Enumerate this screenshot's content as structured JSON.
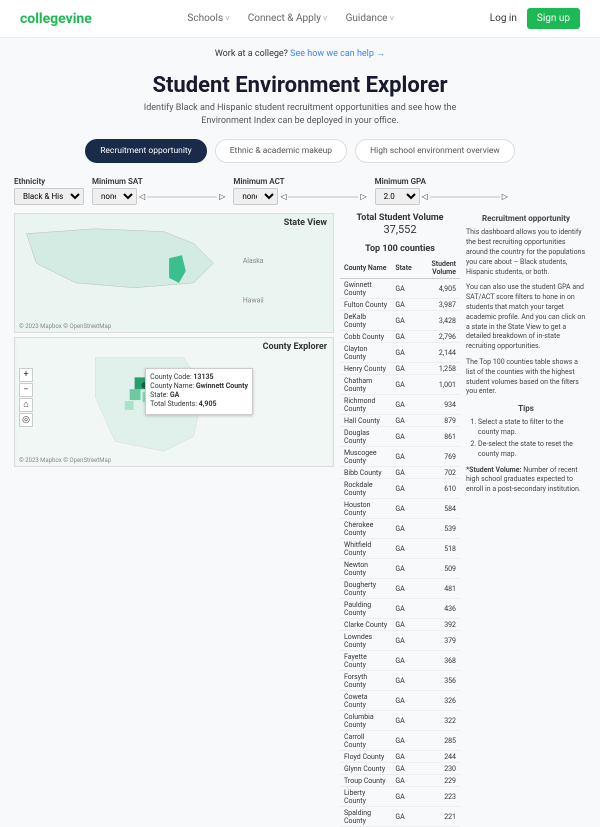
{
  "nav": {
    "logo_a": "college",
    "logo_b": "vine",
    "links": [
      "Schools",
      "Connect & Apply",
      "Guidance"
    ],
    "login": "Log in",
    "signup": "Sign up"
  },
  "banner": {
    "prefix": "Work at a college? ",
    "link": "See how we can help  →"
  },
  "title": "Student Environment Explorer",
  "subtitle": "Identify Black and Hispanic student recruitment opportunities and see how the Environment Index can be deployed in your office.",
  "tabs": [
    "Recruitment opportunity",
    "Ethnic & academic makeup",
    "High school environment overview"
  ],
  "filters": {
    "ethnicity": {
      "label": "Ethnicity",
      "value": "Black & Hispanic"
    },
    "min_sat": {
      "label": "Minimum SAT",
      "value": "none"
    },
    "min_act": {
      "label": "Minimum ACT",
      "value": "none"
    },
    "min_gpa": {
      "label": "Minimum GPA",
      "value": "2.0"
    }
  },
  "maps": {
    "state_title": "State View",
    "county_title": "County Explorer",
    "attrib": "© 2023 Mapbox  © OpenStreetMap",
    "alaska": "Alaska",
    "hawaii": "Hawaii",
    "tooltip": {
      "code_label": "County Code:",
      "code": "13135",
      "name_label": "County Name:",
      "name": "Gwinnett County",
      "state_label": "State:",
      "state": "GA",
      "vol_label": "Total Students:",
      "vol": "4,905"
    }
  },
  "totals": {
    "label": "Total Student Volume",
    "value": "37,552"
  },
  "table": {
    "title": "Top 100 counties",
    "headers": [
      "County Name",
      "State",
      "Student Volume"
    ],
    "rows": [
      [
        "Gwinnett County",
        "GA",
        "4,905"
      ],
      [
        "Fulton County",
        "GA",
        "3,987"
      ],
      [
        "DeKalb County",
        "GA",
        "3,428"
      ],
      [
        "Cobb County",
        "GA",
        "2,796"
      ],
      [
        "Clayton County",
        "GA",
        "2,144"
      ],
      [
        "Henry County",
        "GA",
        "1,258"
      ],
      [
        "Chatham County",
        "GA",
        "1,001"
      ],
      [
        "Richmond County",
        "GA",
        "934"
      ],
      [
        "Hall County",
        "GA",
        "879"
      ],
      [
        "Douglas County",
        "GA",
        "861"
      ],
      [
        "Muscogee County",
        "GA",
        "769"
      ],
      [
        "Bibb County",
        "GA",
        "702"
      ],
      [
        "Rockdale County",
        "GA",
        "610"
      ],
      [
        "Houston County",
        "GA",
        "584"
      ],
      [
        "Cherokee County",
        "GA",
        "539"
      ],
      [
        "Whitfield County",
        "GA",
        "518"
      ],
      [
        "Newton County",
        "GA",
        "509"
      ],
      [
        "Dougherty County",
        "GA",
        "481"
      ],
      [
        "Paulding County",
        "GA",
        "436"
      ],
      [
        "Clarke County",
        "GA",
        "392"
      ],
      [
        "Lowndes County",
        "GA",
        "379"
      ],
      [
        "Fayette County",
        "GA",
        "368"
      ],
      [
        "Forsyth County",
        "GA",
        "356"
      ],
      [
        "Coweta County",
        "GA",
        "326"
      ],
      [
        "Columbia County",
        "GA",
        "322"
      ],
      [
        "Carroll County",
        "GA",
        "285"
      ],
      [
        "Floyd County",
        "GA",
        "244"
      ],
      [
        "Glynn County",
        "GA",
        "230"
      ],
      [
        "Troup County",
        "GA",
        "229"
      ],
      [
        "Liberty County",
        "GA",
        "223"
      ],
      [
        "Spalding County",
        "GA",
        "221"
      ]
    ]
  },
  "sidebar": {
    "heading1": "Recruitment opportunity",
    "p1": "This dashboard allows you to identify the best recruiting opportunities around the country for the populations you care about – Black students, Hispanic students, or both.",
    "p2": "You can also use the student GPA and SAT/ACT score filters to hone in on students that match your target academic profile. And you can click on a state in the State View to get a detailed breakdown of in-state recruiting opportunities.",
    "p3": "The Top 100 counties table shows a list of the counties with the highest student volumes based on the filters you enter.",
    "heading2": "Tips",
    "tip1": "Select a state to filter to the county map.",
    "tip2": "De-select the state to reset the county map.",
    "note_label": "*Student Volume:",
    "note": " Number of recent high school graduates expected to enroll in a post-secondary institution."
  }
}
